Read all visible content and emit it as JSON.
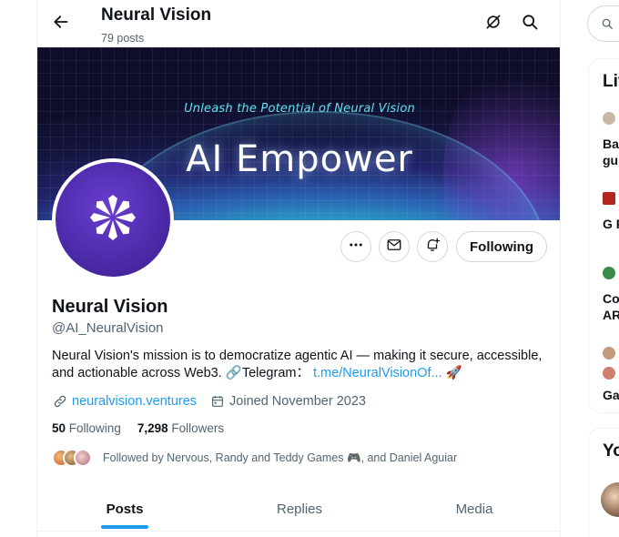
{
  "header": {
    "title": "Neural Vision",
    "post_count": "79 posts"
  },
  "banner": {
    "tagline": "Unleash the Potential of Neural Vision",
    "headline": "AI Empower"
  },
  "actions": {
    "following_label": "Following"
  },
  "profile": {
    "name": "Neural Vision",
    "handle": "@AI_NeuralVision",
    "bio_text": "Neural Vision's mission is to democratize agentic AI — making it secure, accessible, and actionable across Web3. 🔗Telegram：",
    "bio_link": "t.me/NeuralVisionOf...",
    "bio_emoji": "🚀",
    "website": "neuralvision.ventures",
    "joined": "Joined November 2023",
    "following_count": "50",
    "following_label": "Following",
    "followers_count": "7,298",
    "followers_label": "Followers",
    "followed_by": "Followed by Nervous, Randy and Teddy Games 🎮, and Daniel Aguiar"
  },
  "tabs": [
    {
      "label": "Posts",
      "active": true
    },
    {
      "label": "Replies",
      "active": false
    },
    {
      "label": "Media",
      "active": false
    }
  ],
  "sidebar": {
    "search_glyph": "S",
    "live_heading": "Liv",
    "items": [
      {
        "line1": "Bay",
        "line2": "gu"
      },
      {
        "line1": "G F"
      },
      {
        "line1": "Co",
        "line2": "AR"
      },
      {
        "line1": "Ga"
      }
    ],
    "you_heading": "Yo"
  },
  "colors": {
    "accent": "#1d9bf0",
    "text_primary": "#0f1419",
    "text_secondary": "#536471",
    "avatar_purple": "#4b2aa8"
  }
}
